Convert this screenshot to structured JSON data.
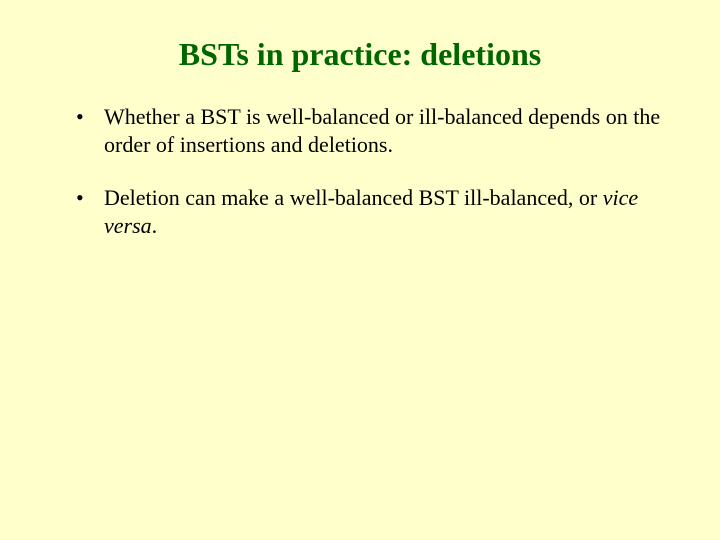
{
  "title": "BSTs in practice: deletions",
  "bullets": {
    "b0": "Whether a BST is well-balanced or ill-balanced depends on the order of insertions and deletions.",
    "b1_a": "Deletion can make a well-balanced BST ill-balanced, or ",
    "b1_italic": "vice versa",
    "b1_b": "."
  }
}
